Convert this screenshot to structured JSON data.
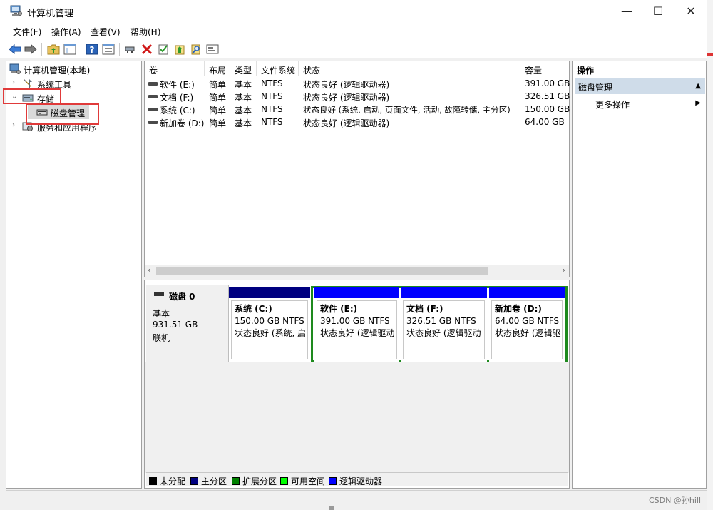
{
  "window": {
    "title": "计算机管理"
  },
  "window_controls": {
    "minimize": "—",
    "maximize": "☐",
    "close": "✕"
  },
  "menu": [
    "文件(F)",
    "操作(A)",
    "查看(V)",
    "帮助(H)"
  ],
  "tree": {
    "root": "计算机管理(本地)",
    "system_tools": "系统工具",
    "storage": "存储",
    "disk_management": "磁盘管理",
    "services": "服务和应用程序"
  },
  "volume_list": {
    "columns": [
      "卷",
      "布局",
      "类型",
      "文件系统",
      "状态",
      "容量"
    ],
    "rows": [
      {
        "volume": "软件 (E:)",
        "layout": "简单",
        "type": "基本",
        "fs": "NTFS",
        "status": "状态良好 (逻辑驱动器)",
        "capacity": "391.00 GB"
      },
      {
        "volume": "文档 (F:)",
        "layout": "简单",
        "type": "基本",
        "fs": "NTFS",
        "status": "状态良好 (逻辑驱动器)",
        "capacity": "326.51 GB"
      },
      {
        "volume": "系统 (C:)",
        "layout": "简单",
        "type": "基本",
        "fs": "NTFS",
        "status": "状态良好 (系统, 启动, 页面文件, 活动, 故障转储, 主分区)",
        "capacity": "150.00 GB"
      },
      {
        "volume": "新加卷 (D:)",
        "layout": "简单",
        "type": "基本",
        "fs": "NTFS",
        "status": "状态良好 (逻辑驱动器)",
        "capacity": "64.00 GB"
      }
    ]
  },
  "disk": {
    "title": "磁盘 0",
    "type": "基本",
    "size": "931.51 GB",
    "state": "联机",
    "partitions": [
      {
        "name": "系统  (C:)",
        "size": "150.00 GB NTFS",
        "status": "状态良好 (系统, 启",
        "bar_color": "#000080"
      },
      {
        "name": "软件  (E:)",
        "size": "391.00 GB NTFS",
        "status": "状态良好 (逻辑驱动",
        "bar_color": "#0000ff"
      },
      {
        "name": "文档  (F:)",
        "size": "326.51 GB NTFS",
        "status": "状态良好 (逻辑驱动",
        "bar_color": "#0000ff"
      },
      {
        "name": "新加卷  (D:)",
        "size": "64.00 GB NTFS",
        "status": "状态良好 (逻辑驱",
        "bar_color": "#0000ff"
      }
    ]
  },
  "legend": [
    {
      "label": "未分配",
      "color": "#000000"
    },
    {
      "label": "主分区",
      "color": "#000080"
    },
    {
      "label": "扩展分区",
      "color": "#008000"
    },
    {
      "label": "可用空间",
      "color": "#00ff00"
    },
    {
      "label": "逻辑驱动器",
      "color": "#0000ff"
    }
  ],
  "actions": {
    "header": "操作",
    "section": "磁盘管理",
    "more": "更多操作"
  },
  "watermark": "CSDN @孙hill"
}
